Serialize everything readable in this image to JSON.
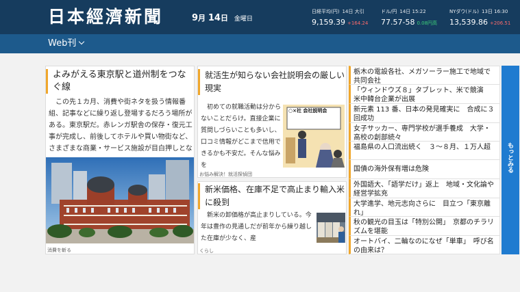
{
  "header": {
    "logo": "日本經濟新聞",
    "date": {
      "month": "9",
      "month_unit": "月",
      "day": "14",
      "day_unit": "日",
      "weekday": "金曜日"
    },
    "tickers": [
      {
        "label": "日経平均(円)",
        "time": "14日 大引",
        "value": "9,159.39",
        "change": "+164.24",
        "dir": "up"
      },
      {
        "label": "ドル/円",
        "time": "14日 15:22",
        "value": "77.57-58",
        "change": "0.08円高",
        "dir": "down"
      },
      {
        "label": "NYダウ(ドル)",
        "time": "13日 16:30",
        "value": "13,539.86",
        "change": "+206.51",
        "dir": "up"
      }
    ]
  },
  "nav": {
    "label": "Web刊"
  },
  "articles": {
    "tokyo": {
      "title": "よみがえる東京駅と道州制をつなぐ線",
      "body": "この先１カ月、消費や街ネタを扱う情報番組、記事などに繰り返し登場するだろう場所がある。東京駅だ。赤レンガ駅舎の保存・復元工事が完成し、前後してホテルや買い物街など、さまざまな商業・サービス施設が目白押しとなる。",
      "caption": "消費を斬る"
    },
    "shukatsu": {
      "title": "就活生が知らない会社説明会の厳しい現実",
      "body": "初めての就職活動は分からないことだらけ。直接企業に質問しづらいことも多いし、口コミ情報がどこまで信用できるかも不安だ。そんな悩みを",
      "caption": "お悩み解決！就活探偵団",
      "sign": "○×社 会社説明会"
    },
    "rice": {
      "title": "新米価格、在庫不足で高止まり輸入米に殺到",
      "body": "新米の卸価格が高止まりしている。今年は豊作の見通しだが前年から繰り越した在庫が少なく、産",
      "caption": "くらし"
    }
  },
  "headlines": [
    "栃木の電設各社、メガソーラー施工で地域で共同会社",
    "「ウィンドウズ８」タブレット、米で競演　米中韓台企業が出展",
    "新元素 113 番、日本の発見確実に　合成に３回成功",
    "女子サッカー、専門学校が選手養成　大学・高校の創部続々",
    "福島県の人口流出続く　３～８月、１万人超",
    "国債の海外保有増は危険",
    "外国語大、「語学だけ」返上　地域・文化論や経営学拡充",
    "大学進学、地元志向さらに　目立つ「東京離れ」",
    "秋の観光の目玉は「特別公開」　京都のチラリズムを堪能",
    "オートバイ、二輪なのになぜ「単車」　呼び名の由来は？"
  ],
  "more_label": "もっとみる",
  "colors": {
    "header": "#163c5e",
    "nav": "#1d5a8c",
    "accent": "#f0a72c",
    "more": "#1f7bd0",
    "up": "#ff6b6b",
    "down": "#3ed17a"
  }
}
